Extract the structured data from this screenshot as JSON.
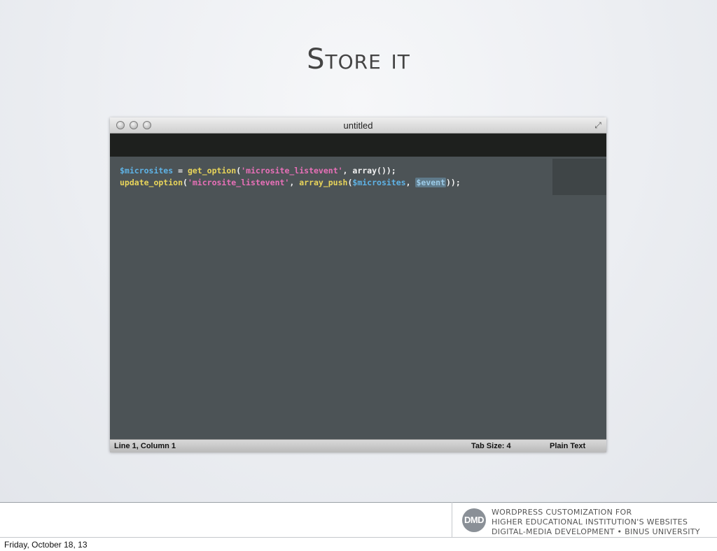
{
  "slide": {
    "title": "Store it"
  },
  "window": {
    "title": "untitled",
    "code_lines": [
      [
        {
          "cls": "var",
          "text": "$microsites"
        },
        {
          "cls": "plain",
          "text": " = "
        },
        {
          "cls": "fn",
          "text": "get_option"
        },
        {
          "cls": "plain",
          "text": "("
        },
        {
          "cls": "str",
          "text": "'microsite_listevent'"
        },
        {
          "cls": "plain",
          "text": ", "
        },
        {
          "cls": "kw",
          "text": "array"
        },
        {
          "cls": "plain",
          "text": "());"
        }
      ],
      [
        {
          "cls": "fn",
          "text": "update_option"
        },
        {
          "cls": "plain",
          "text": "("
        },
        {
          "cls": "str",
          "text": "'microsite_listevent'"
        },
        {
          "cls": "plain",
          "text": ", "
        },
        {
          "cls": "fn",
          "text": "array_push"
        },
        {
          "cls": "plain",
          "text": "("
        },
        {
          "cls": "var",
          "text": "$microsites"
        },
        {
          "cls": "plain",
          "text": ", "
        },
        {
          "cls": "sel",
          "text": "$event"
        },
        {
          "cls": "plain",
          "text": "));"
        }
      ]
    ],
    "status": {
      "position": "Line 1, Column 1",
      "tab_size": "Tab Size: 4",
      "syntax": "Plain Text"
    }
  },
  "footer": {
    "logo_text": "DMD",
    "lines": [
      "WordPress Customization for",
      "Higher Educational Institution's Websites",
      "Digital-Media Development • BINUS University"
    ],
    "date": "Friday, October 18, 13"
  }
}
